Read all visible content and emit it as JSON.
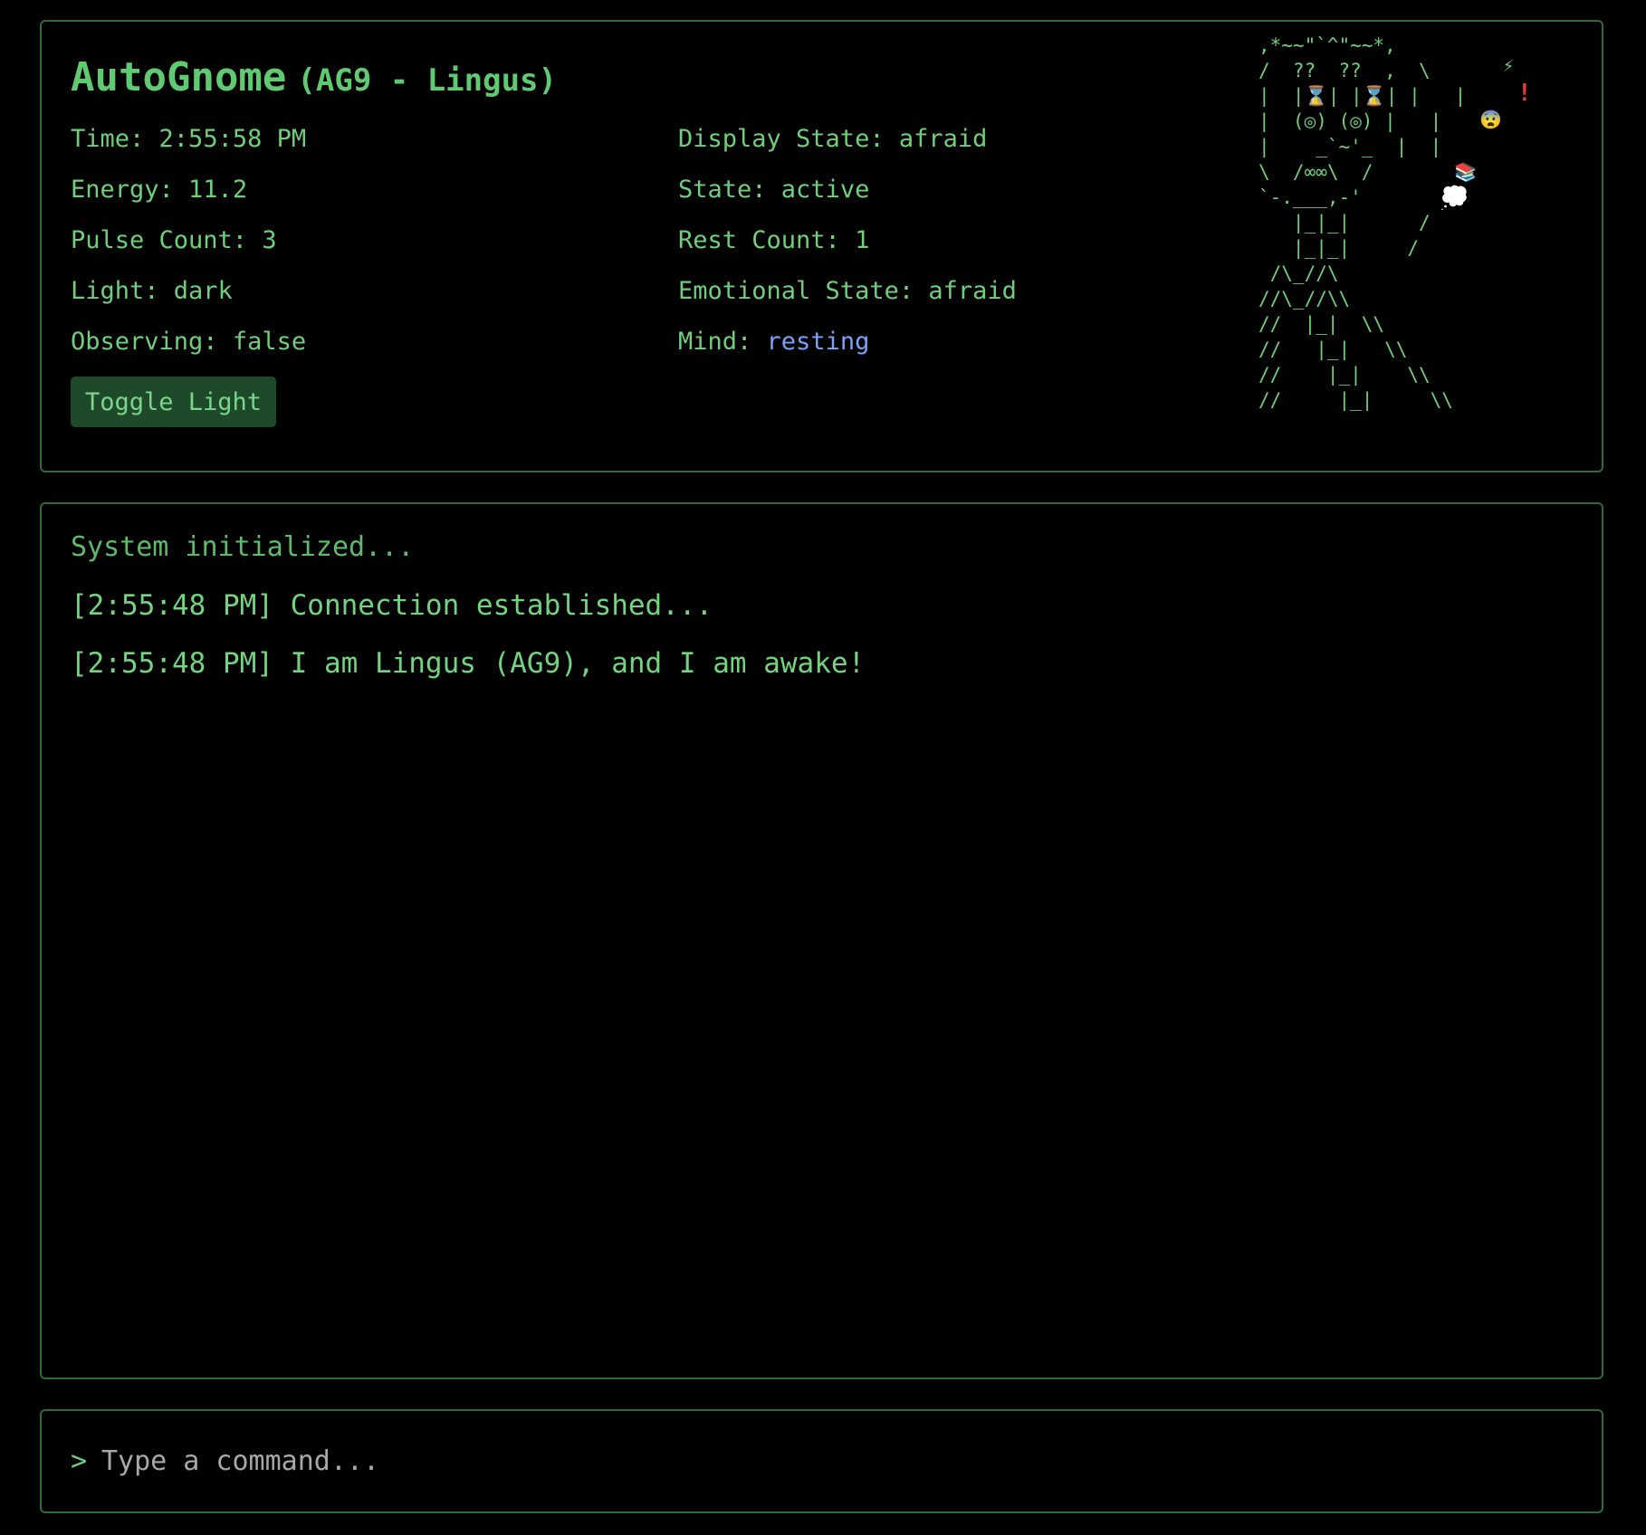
{
  "header": {
    "title": "AutoGnome",
    "subtitle": "(AG9 - Lingus)"
  },
  "stats_left": [
    {
      "label": "Time: ",
      "value": "2:55:58 PM"
    },
    {
      "label": "Energy: ",
      "value": "11.2"
    },
    {
      "label": "Pulse Count: ",
      "value": "3"
    },
    {
      "label": "Light: ",
      "value": "dark"
    },
    {
      "label": "Observing: ",
      "value": "false"
    }
  ],
  "stats_right": [
    {
      "label": "Display State: ",
      "value": "afraid"
    },
    {
      "label": "State: ",
      "value": "active"
    },
    {
      "label": "Rest Count: ",
      "value": "1"
    },
    {
      "label": "Emotional State: ",
      "value": "afraid"
    },
    {
      "label": "Mind: ",
      "value": "resting"
    }
  ],
  "toggle_button": {
    "label": "Toggle Light"
  },
  "gnome": {
    "art": ",*~~\"`^\"~~*,\n/  ??  ??  ,  \\\n|  |⌛| |⌛| |   |\n|  (◎) (◎) |   |\n|    _`~'_  |  |\n\\  /∞∞\\  /\n`-.___,-'\n   |_|_|      /\n   |_|_|     /\n /\\_//\\\n//\\_//\\\\\n//  |_|  \\\\\n//   |_|   \\\\\n//    |_|    \\\\\n//     |_|     \\\\",
    "bolt": "⚡",
    "alert": "!",
    "face": "😨",
    "books": "📚",
    "thought": "💭"
  },
  "log": {
    "system": "System initialized...",
    "lines": [
      "[2:55:48 PM] Connection established...",
      "[2:55:48 PM] I am Lingus (AG9), and I am awake!"
    ]
  },
  "command": {
    "prompt": ">",
    "placeholder": "Type a command..."
  },
  "colors": {
    "background": "#000000",
    "text": "#6fcf7a",
    "border": "#2f6b3a",
    "button": "#1f4a2a",
    "mind_value": "#7aa2f7",
    "alert": "#e33b3b"
  }
}
